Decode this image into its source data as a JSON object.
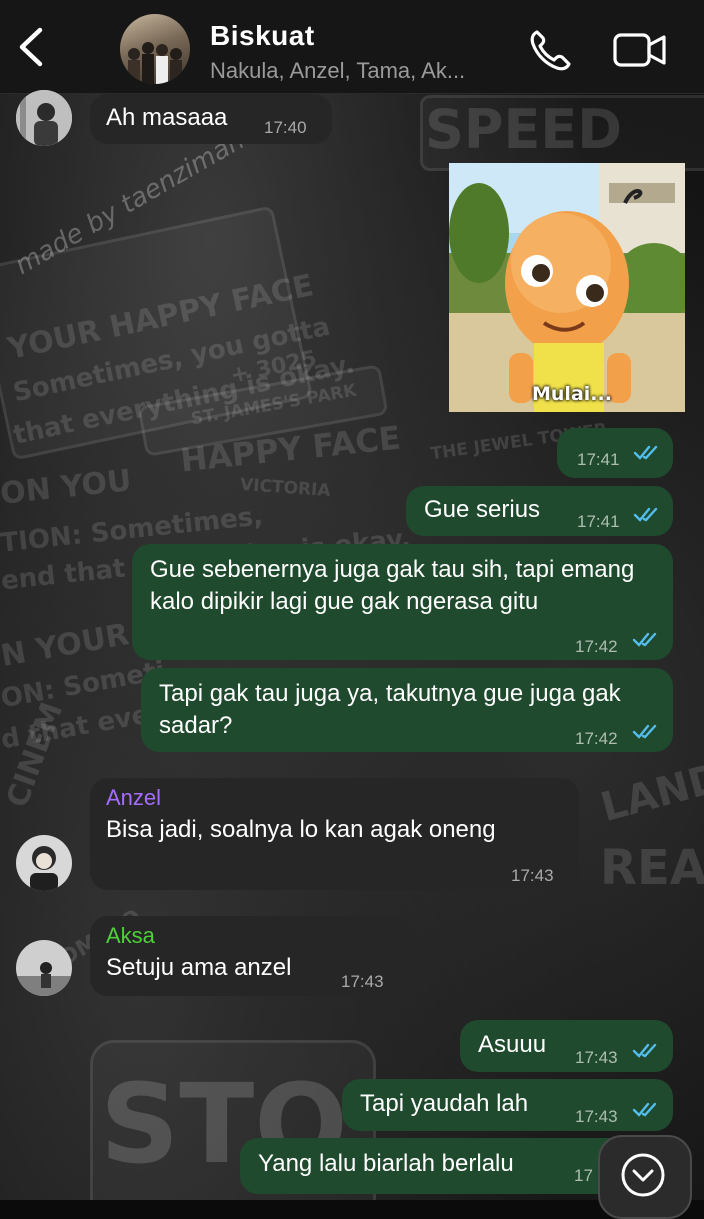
{
  "header": {
    "title": "Biskuat",
    "members": "Nakula, Anzel, Tama, Ak...",
    "back_icon": "chevron-left-icon",
    "call_icon": "phone-icon",
    "video_icon": "video-camera-icon"
  },
  "background": {
    "watermark": "made by taenzimant",
    "signs": [
      "SPEED",
      "YOUR HAPPY FACE",
      "Sometimes, you gotta",
      "that everything is okay.",
      "+ 3025",
      "ST. JAMES'S PARK",
      "HAPPY FACE",
      "ON YOU",
      "VICTORIA",
      "THE JEWEL TOWER",
      "TION: Sometimes,",
      "end that everything is okay.",
      "N YOUR H",
      "ON: Someti",
      "d that every",
      "CINEM",
      "ADMIT O",
      "LAND",
      "READ",
      "STO"
    ]
  },
  "messages": [
    {
      "direction": "in",
      "text": "Ah masaaa",
      "time": "17:40"
    },
    {
      "direction": "out",
      "type": "image",
      "caption": "Mulai...",
      "time": "17:41",
      "ticks": "read"
    },
    {
      "direction": "out",
      "text": "Gue serius",
      "time": "17:41",
      "ticks": "read"
    },
    {
      "direction": "out",
      "text": "Gue sebenernya juga gak tau sih, tapi emang kalo dipikir lagi gue gak ngerasa gitu",
      "time": "17:42",
      "ticks": "read"
    },
    {
      "direction": "out",
      "text": "Tapi gak tau juga ya, takutnya gue juga gak sadar?",
      "time": "17:42",
      "ticks": "read"
    },
    {
      "direction": "in",
      "sender": "Anzel",
      "sender_color": "#a66cff",
      "text": "Bisa jadi, soalnya lo kan agak oneng",
      "time": "17:43"
    },
    {
      "direction": "in",
      "sender": "Aksa",
      "sender_color": "#4cd137",
      "text": "Setuju ama anzel",
      "time": "17:43"
    },
    {
      "direction": "out",
      "text": "Asuuu",
      "time": "17:43",
      "ticks": "read"
    },
    {
      "direction": "out",
      "text": "Tapi yaudah lah",
      "time": "17:43",
      "ticks": "read"
    },
    {
      "direction": "out",
      "text": "Yang lalu biarlah berlalu",
      "time": "17",
      "ticks": "hidden"
    }
  ],
  "scroll_button_icon": "chevron-down-icon",
  "colors": {
    "outgoing": "#1f4a2e",
    "incoming": "#262626",
    "read_ticks": "#53bdeb"
  }
}
